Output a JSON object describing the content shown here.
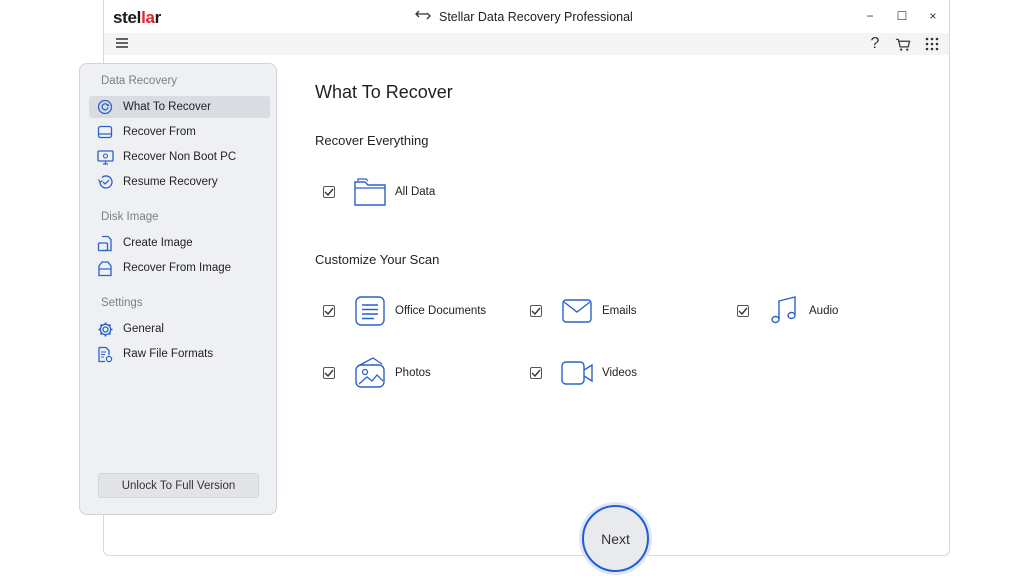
{
  "app": {
    "logo_prefix": "stel",
    "logo_accent": "la",
    "logo_suffix": "r",
    "window_title": "Stellar Data Recovery Professional"
  },
  "window_controls": {
    "minimize": "−",
    "maximize": "☐",
    "close": "×"
  },
  "toolbar": {
    "help": "?"
  },
  "sidebar": {
    "sections": [
      {
        "title": "Data Recovery",
        "items": [
          {
            "label": "What To Recover",
            "icon": "target-icon",
            "active": true
          },
          {
            "label": "Recover From",
            "icon": "drive-icon"
          },
          {
            "label": "Recover Non Boot PC",
            "icon": "monitor-icon"
          },
          {
            "label": "Resume Recovery",
            "icon": "resume-icon"
          }
        ]
      },
      {
        "title": "Disk Image",
        "items": [
          {
            "label": "Create Image",
            "icon": "create-image-icon"
          },
          {
            "label": "Recover From Image",
            "icon": "recover-image-icon"
          }
        ]
      },
      {
        "title": "Settings",
        "items": [
          {
            "label": "General",
            "icon": "gear-icon"
          },
          {
            "label": "Raw File Formats",
            "icon": "file-format-icon"
          }
        ]
      }
    ],
    "unlock_label": "Unlock To Full Version"
  },
  "main": {
    "title": "What To Recover",
    "recover_everything": {
      "heading": "Recover Everything",
      "option": {
        "label": "All Data",
        "icon": "folder-icon",
        "checked": true
      }
    },
    "customize": {
      "heading": "Customize Your Scan",
      "options": [
        {
          "label": "Office Documents",
          "icon": "document-icon",
          "checked": true
        },
        {
          "label": "Emails",
          "icon": "envelope-icon",
          "checked": true
        },
        {
          "label": "Audio",
          "icon": "music-note-icon",
          "checked": true
        },
        {
          "label": "Photos",
          "icon": "photos-icon",
          "checked": true
        },
        {
          "label": "Videos",
          "icon": "video-camera-icon",
          "checked": true
        }
      ]
    }
  },
  "next_label": "Next",
  "colors": {
    "accent": "#1f5fd1",
    "logo_red": "#e3262b",
    "sidebar_bg": "#eef0f3"
  }
}
